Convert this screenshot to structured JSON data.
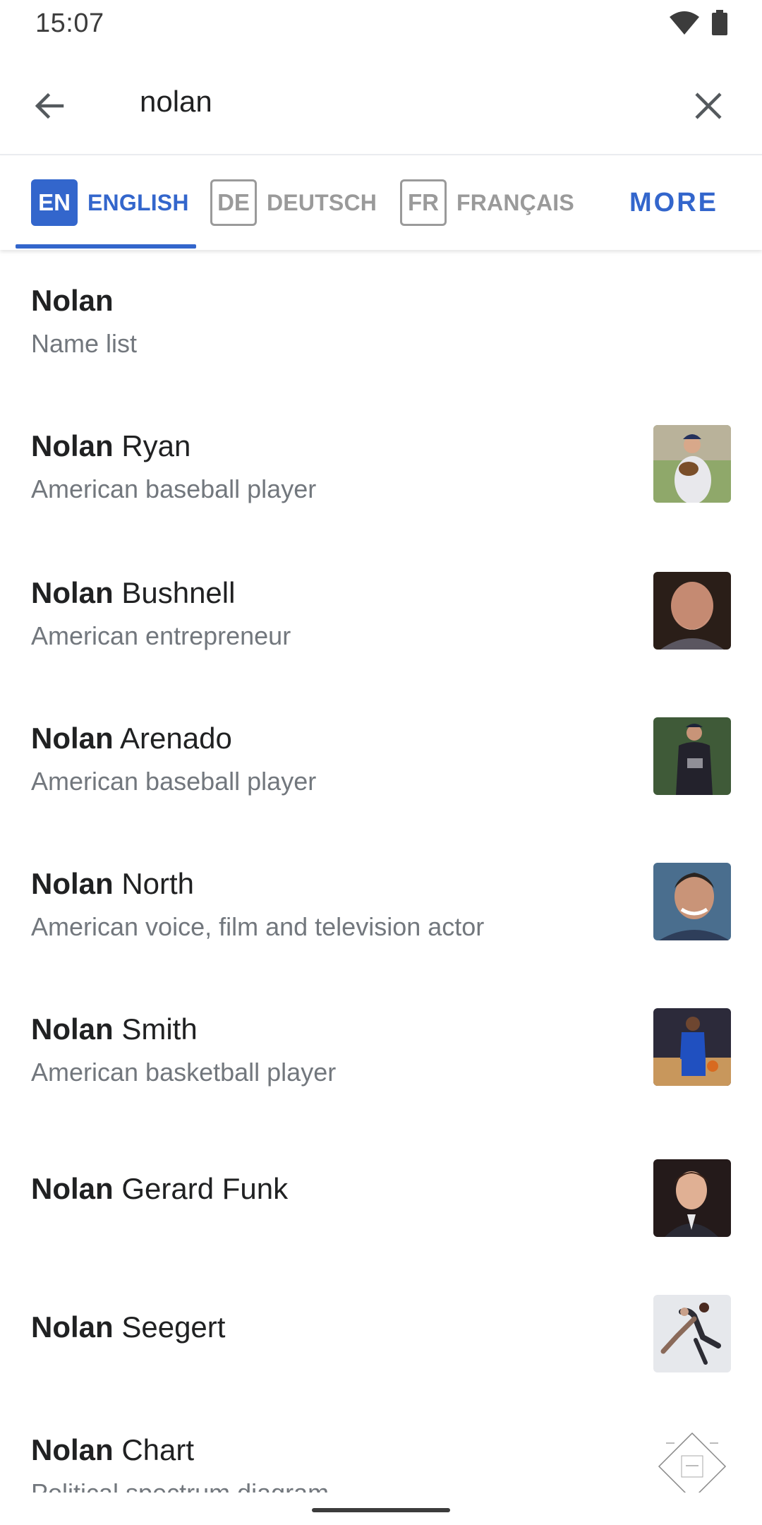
{
  "status_bar": {
    "time": "15:07"
  },
  "search": {
    "query": "nolan"
  },
  "language_tabs": [
    {
      "code": "EN",
      "name": "ENGLISH"
    },
    {
      "code": "DE",
      "name": "DEUTSCH"
    },
    {
      "code": "FR",
      "name": "FRANÇAIS"
    }
  ],
  "more_label": "MORE",
  "results": [
    {
      "bold": "Nolan",
      "rest": "",
      "description": "Name list"
    },
    {
      "bold": "Nolan",
      "rest": " Ryan",
      "description": "American baseball player",
      "thumb": "baseball-player-photo"
    },
    {
      "bold": "Nolan",
      "rest": " Bushnell",
      "description": "American entrepreneur",
      "thumb": "portrait-photo"
    },
    {
      "bold": "Nolan",
      "rest": " Arenado",
      "description": "American baseball player",
      "thumb": "baseball-player-photo"
    },
    {
      "bold": "Nolan",
      "rest": " North",
      "description": "American voice, film and television actor",
      "thumb": "portrait-photo"
    },
    {
      "bold": "Nolan",
      "rest": " Smith",
      "description": "American basketball player",
      "thumb": "basketball-player-photo"
    },
    {
      "bold": "Nolan",
      "rest": " Gerard Funk",
      "description": "",
      "thumb": "portrait-photo"
    },
    {
      "bold": "Nolan",
      "rest": " Seegert",
      "description": "",
      "thumb": "figure-skating-photo"
    },
    {
      "bold": "Nolan",
      "rest": " Chart",
      "description": "Political spectrum diagram",
      "thumb": "diagram-image"
    }
  ],
  "colors": {
    "accent": "#3366cc",
    "text": "#202122",
    "secondary_text": "#72777d",
    "inactive": "#9a9a9a"
  }
}
